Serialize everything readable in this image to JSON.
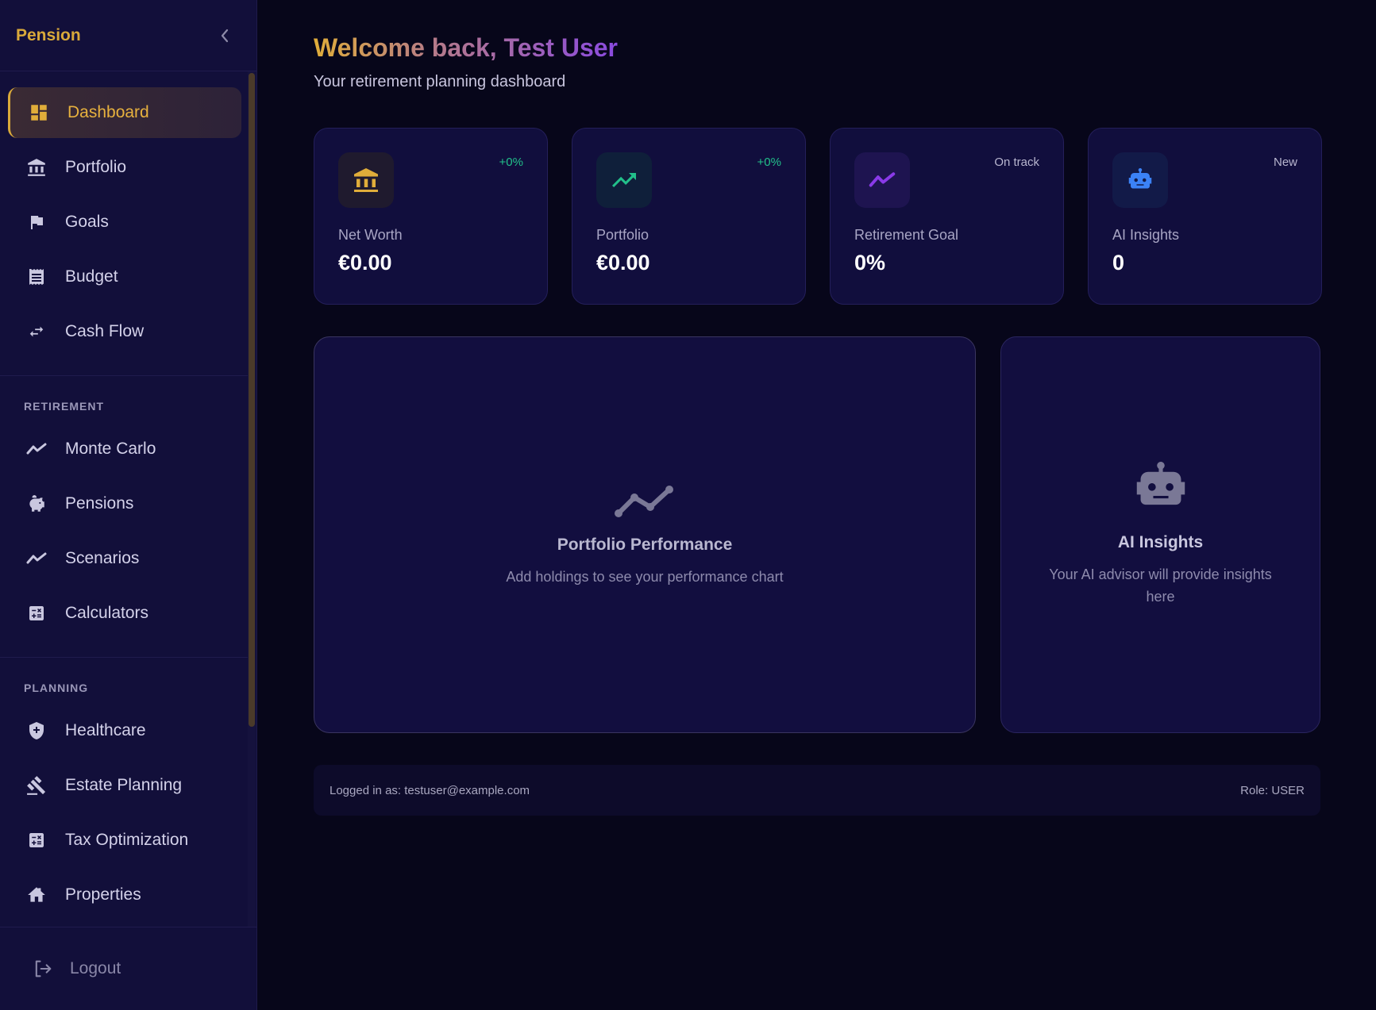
{
  "sidebar": {
    "brand": "Pension",
    "main_items": [
      {
        "label": "Dashboard",
        "icon": "dashboard-icon",
        "active": true
      },
      {
        "label": "Portfolio",
        "icon": "bank-icon"
      },
      {
        "label": "Goals",
        "icon": "flag-icon"
      },
      {
        "label": "Budget",
        "icon": "receipt-icon"
      },
      {
        "label": "Cash Flow",
        "icon": "swap-arrows-icon"
      }
    ],
    "retirement": {
      "label": "RETIREMENT",
      "items": [
        {
          "label": "Monte Carlo",
          "icon": "trend-line-icon"
        },
        {
          "label": "Pensions",
          "icon": "piggy-bank-icon"
        },
        {
          "label": "Scenarios",
          "icon": "trend-line-icon"
        },
        {
          "label": "Calculators",
          "icon": "calculator-icon"
        }
      ]
    },
    "planning": {
      "label": "PLANNING",
      "items": [
        {
          "label": "Healthcare",
          "icon": "shield-plus-icon"
        },
        {
          "label": "Estate Planning",
          "icon": "gavel-icon"
        },
        {
          "label": "Tax Optimization",
          "icon": "calculator-icon"
        },
        {
          "label": "Properties",
          "icon": "house-icon"
        }
      ]
    },
    "logout": "Logout"
  },
  "header": {
    "welcome": "Welcome back, Test User",
    "subtitle": "Your retirement planning dashboard"
  },
  "stats": [
    {
      "label": "Net Worth",
      "value": "€0.00",
      "badge": "+0%",
      "badge_color": "#22c08a",
      "icon": "bank-icon",
      "icon_bg": "#1f1a2e",
      "icon_color": "#e0ad3a"
    },
    {
      "label": "Portfolio",
      "value": "€0.00",
      "badge": "+0%",
      "badge_color": "#22c08a",
      "icon": "trending-up-icon",
      "icon_bg": "#0f1f3a",
      "icon_color": "#22c08a"
    },
    {
      "label": "Retirement Goal",
      "value": "0%",
      "badge": "On track",
      "badge_color": "#b8b6cf",
      "icon": "trend-line-icon",
      "icon_bg": "#1e1450",
      "icon_color": "#8a3ae8"
    },
    {
      "label": "AI Insights",
      "value": "0",
      "badge": "New",
      "badge_color": "#b8b6cf",
      "icon": "robot-icon",
      "icon_bg": "#121a48",
      "icon_color": "#3b82f6"
    }
  ],
  "performance": {
    "title": "Portfolio Performance",
    "text": "Add holdings to see your performance chart"
  },
  "ai_panel": {
    "title": "AI Insights",
    "text": "Your AI advisor will provide insights here"
  },
  "footer": {
    "logged_in": "Logged in as: testuser@example.com",
    "role": "Role: USER"
  }
}
